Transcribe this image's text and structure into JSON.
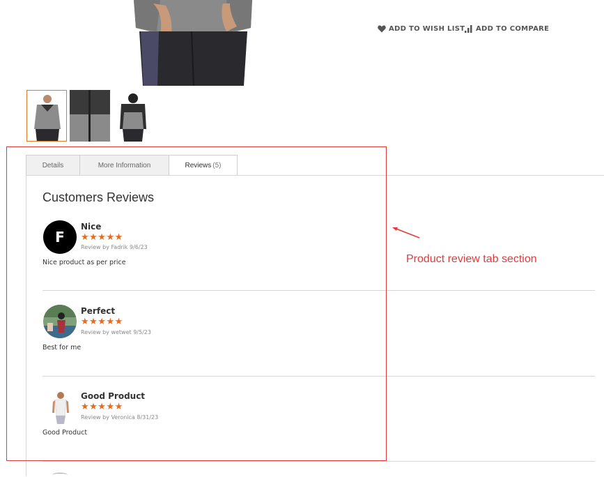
{
  "actions": {
    "wishlist": "ADD TO WISH LIST",
    "compare": "ADD TO COMPARE"
  },
  "tabs": [
    {
      "label": "Details"
    },
    {
      "label": "More Information"
    },
    {
      "label": "Reviews",
      "count": "(5)"
    }
  ],
  "reviews_section": {
    "title": "Customers Reviews",
    "items": [
      {
        "title": "Nice",
        "stars": "★★★★★",
        "byline": "Review by Fadrik 9/6/23",
        "text": "Nice product as per price",
        "avatar_letter": "F"
      },
      {
        "title": "Perfect",
        "stars": "★★★★★",
        "byline": "Review by wetwet 9/5/23",
        "text": "Best for me"
      },
      {
        "title": "Good Product",
        "stars": "★★★★★",
        "byline": "Review by Veronica 8/31/23",
        "text": "Good Product"
      }
    ]
  },
  "annotation": {
    "label": "Product review tab section",
    "color": "#e23b3b"
  },
  "colors": {
    "star": "#e86a1e",
    "active_thumb_border": "#e07b2a"
  }
}
